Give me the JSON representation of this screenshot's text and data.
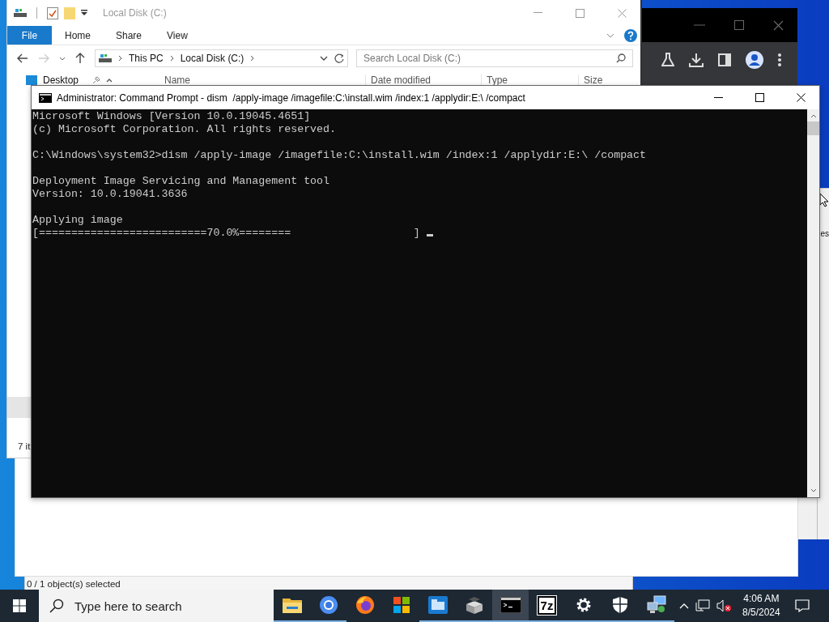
{
  "side_window": {
    "text": "es"
  },
  "background_window": {
    "status": "0 / 1 object(s) selected"
  },
  "explorer": {
    "title": "Local Disk (C:)",
    "file_tab": "File",
    "tabs": [
      {
        "label": "Home",
        "selected": false
      },
      {
        "label": "Share",
        "selected": false
      },
      {
        "label": "View",
        "selected": false
      }
    ],
    "breadcrumbs": [
      "This PC",
      "Local Disk (C:)"
    ],
    "search": {
      "placeholder": "Search Local Disk (C:)"
    },
    "nav_item": "Desktop",
    "columns": [
      "Name",
      "Date modified",
      "Type",
      "Size"
    ],
    "status": "7 it"
  },
  "console": {
    "title": "Administrator: Command Prompt - dism  /apply-image /imagefile:C:\\install.wim /index:1 /applydir:E:\\ /compact",
    "blocks": [
      [
        "Microsoft Windows [Version 10.0.19045.4651]",
        "(c) Microsoft Corporation. All rights reserved."
      ],
      [
        "C:\\Windows\\system32>dism /apply-image /imagefile:C:\\install.wim /index:1 /applydir:E:\\ /compact"
      ],
      [
        "Deployment Image Servicing and Management tool",
        "Version: 10.0.19041.3636"
      ],
      [
        "Applying image",
        "[==========================70.0%========                   ]"
      ]
    ]
  },
  "taskbar": {
    "search_placeholder": "Type here to search",
    "apps": [
      {
        "kind": "explorer",
        "selected": false,
        "running": true
      },
      {
        "kind": "chrome",
        "selected": false,
        "running": true
      },
      {
        "kind": "firefox",
        "selected": false,
        "running": false
      },
      {
        "kind": "store",
        "selected": false,
        "running": false
      },
      {
        "kind": "files",
        "selected": false,
        "running": true
      },
      {
        "kind": "installer",
        "selected": false,
        "running": true
      },
      {
        "kind": "terminal",
        "selected": true,
        "running": true
      },
      {
        "kind": "archiver",
        "label": "7z",
        "selected": false,
        "running": true
      },
      {
        "kind": "settings",
        "selected": false,
        "running": true
      },
      {
        "kind": "security",
        "selected": false,
        "running": true
      },
      {
        "kind": "network",
        "selected": false,
        "running": true
      }
    ],
    "clock": {
      "time": "4:06 AM",
      "date": "8/5/2024"
    }
  }
}
